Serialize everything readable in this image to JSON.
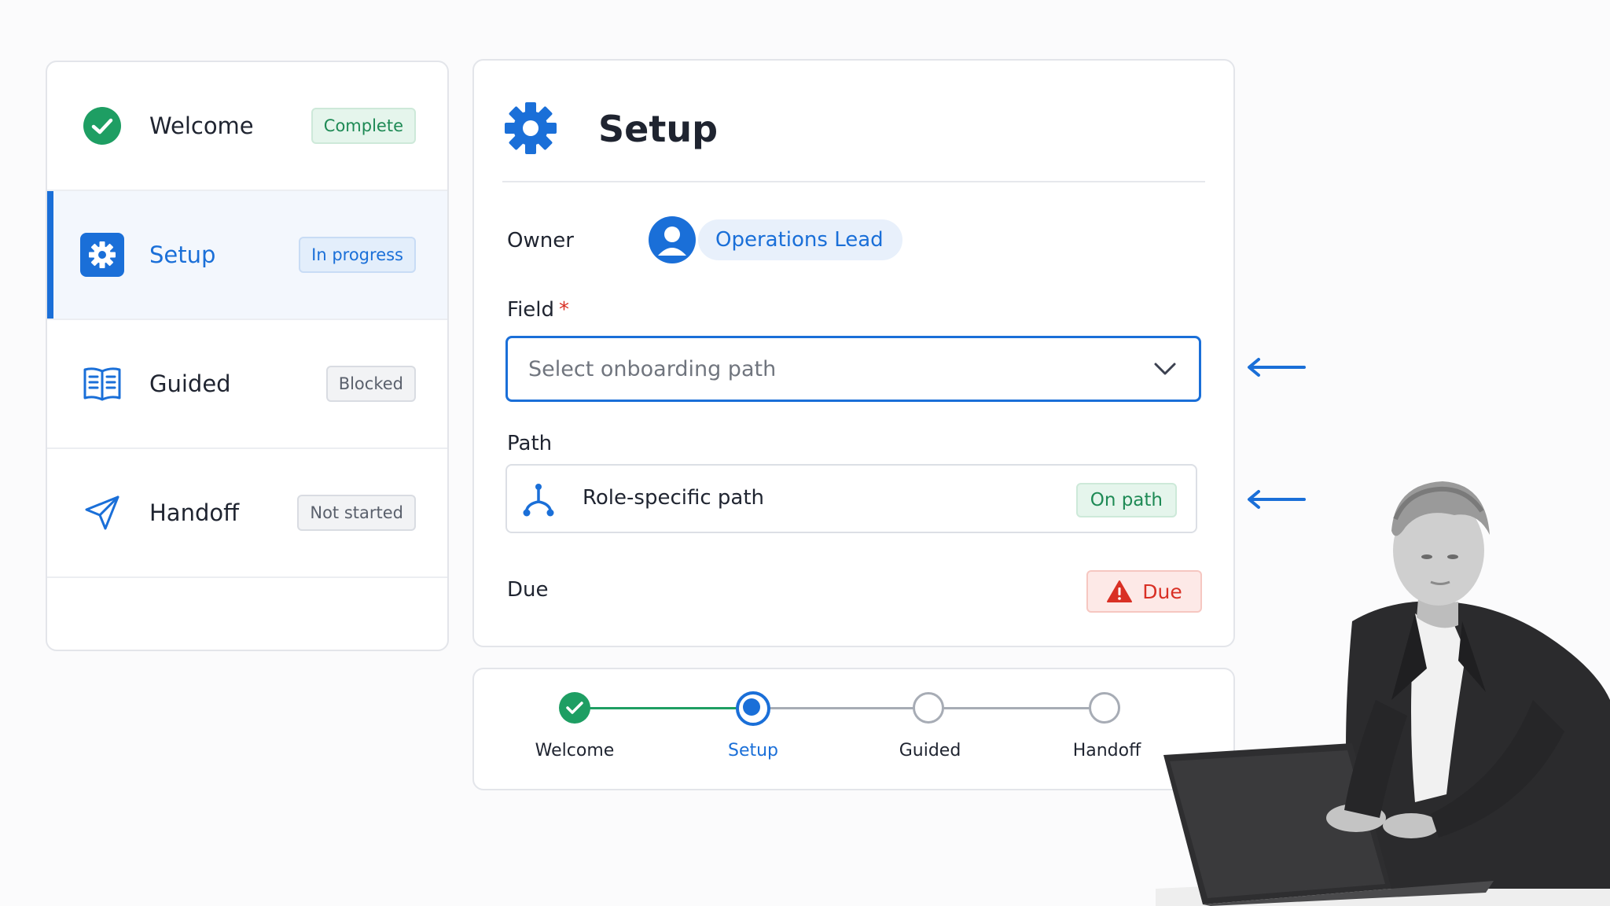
{
  "sidebar": {
    "steps": [
      {
        "label": "Welcome",
        "status": "Complete",
        "icon": "check-circle-icon"
      },
      {
        "label": "Setup",
        "status": "In progress",
        "icon": "gear-icon"
      },
      {
        "label": "Guided",
        "status": "Blocked",
        "icon": "book-icon"
      },
      {
        "label": "Handoff",
        "status": "Not started",
        "icon": "send-icon"
      }
    ]
  },
  "main": {
    "title": "Setup",
    "owner_label": "Owner",
    "owner_value": "Operations Lead",
    "field_label": "Field",
    "required_mark": "*",
    "field_placeholder": "Select onboarding path",
    "path_label": "Path",
    "path_value": "Role-specific path",
    "path_status": "On path",
    "due_label": "Due",
    "due_badge": "Due"
  },
  "stepper": {
    "steps": [
      {
        "label": "Welcome",
        "state": "done"
      },
      {
        "label": "Setup",
        "state": "current"
      },
      {
        "label": "Guided",
        "state": "todo"
      },
      {
        "label": "Handoff",
        "state": "todo"
      }
    ]
  },
  "colors": {
    "accent": "#1a6fd8",
    "success": "#1e9e63",
    "danger": "#d93025",
    "muted": "#a7acb5"
  }
}
